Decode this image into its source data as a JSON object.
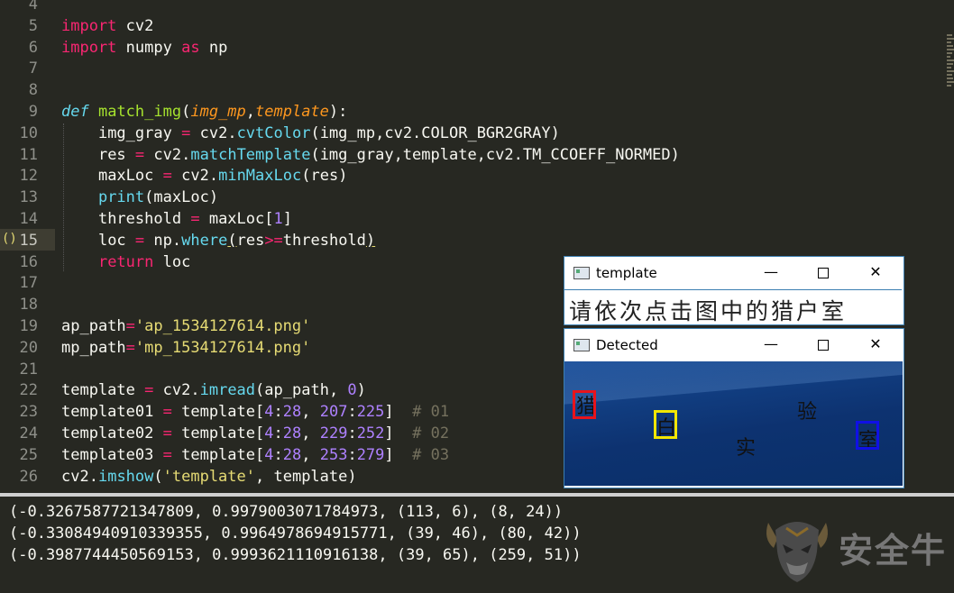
{
  "editor": {
    "lines": [
      {
        "n": "4"
      },
      {
        "n": "5"
      },
      {
        "n": "6"
      },
      {
        "n": "7"
      },
      {
        "n": "8"
      },
      {
        "n": "9"
      },
      {
        "n": "10"
      },
      {
        "n": "11"
      },
      {
        "n": "12"
      },
      {
        "n": "13"
      },
      {
        "n": "14"
      },
      {
        "n": "15"
      },
      {
        "n": "16"
      },
      {
        "n": "17"
      },
      {
        "n": "18"
      },
      {
        "n": "19"
      },
      {
        "n": "20"
      },
      {
        "n": "21"
      },
      {
        "n": "22"
      },
      {
        "n": "23"
      },
      {
        "n": "24"
      },
      {
        "n": "25"
      },
      {
        "n": "26"
      }
    ],
    "gutter_marker": "()",
    "tokens": {
      "import": "import",
      "cv2": "cv2",
      "numpy": "numpy",
      "as": "as",
      "np": "np",
      "def": "def",
      "match_img": "match_img",
      "img_mp": "img_mp",
      "template": "template",
      "img_gray": "img_gray",
      "cvtColor": "cvtColor",
      "color_const": "img_mp,cv2.COLOR_BGR2GRAY)",
      "res": "res",
      "matchTemplate": "matchTemplate",
      "mt_args": "(img_gray,template,cv2.TM_CCOEFF_NORMED)",
      "maxLoc": "maxLoc",
      "minMaxLoc": "minMaxLoc",
      "print": "print",
      "threshold": "threshold",
      "one": "1",
      "loc": "loc",
      "where": "where",
      "return": "return",
      "ap_path": "ap_path",
      "ap_str": "'ap_1534127614.png'",
      "mp_path": "mp_path",
      "mp_str": "'mp_1534127614.png'",
      "imread": "imread",
      "zero": "0",
      "template01": "template01",
      "template02": "template02",
      "template03": "template03",
      "n4": "4",
      "n28": "28",
      "n207": "207",
      "n225": "225",
      "n229": "229",
      "n252": "252",
      "n253": "253",
      "n279": "279",
      "c01": "# 01",
      "c02": "# 02",
      "c03": "# 03",
      "imshow": "imshow",
      "tpl_str": "'template'"
    }
  },
  "console": {
    "lines": [
      "(-0.3267587721347809, 0.9979003071784973, (113, 6), (8, 24))",
      "(-0.33084940910339355, 0.9964978694915771, (39, 46), (80, 42))",
      "(-0.3987744450569153, 0.9993621110916138, (39, 65), (259, 51))"
    ]
  },
  "watermark": {
    "text": "安全牛"
  },
  "template_window": {
    "title": "template",
    "min": "—",
    "close": "✕",
    "content_text": "请依次点击图中的猎户室"
  },
  "detected_window": {
    "title": "Detected",
    "min": "—",
    "close": "✕",
    "chars": [
      "猎",
      "白",
      "实",
      "验",
      "室"
    ],
    "box_colors": {
      "red": "#e8141c",
      "yellow": "#f2e600",
      "blue": "#1010e6"
    }
  }
}
